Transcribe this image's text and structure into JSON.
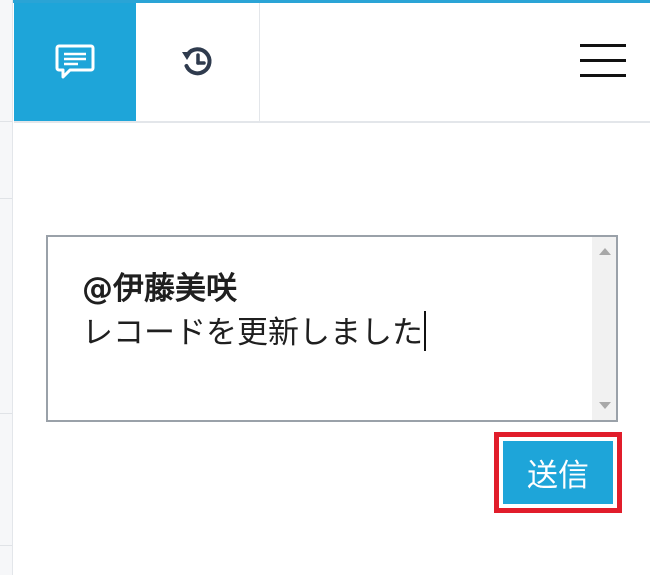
{
  "header": {
    "tabs": [
      {
        "name": "comments",
        "icon": "comment-icon",
        "active": true
      },
      {
        "name": "history",
        "icon": "history-icon",
        "active": false
      }
    ],
    "menu_icon": "hamburger-menu-icon"
  },
  "comment_box": {
    "mention": "@伊藤美咲",
    "text": "レコードを更新しました"
  },
  "send_button": {
    "label": "送信"
  },
  "colors": {
    "accent": "#1ea5d9",
    "highlight": "#e11d2b",
    "icon_dark": "#2f3b4e"
  }
}
